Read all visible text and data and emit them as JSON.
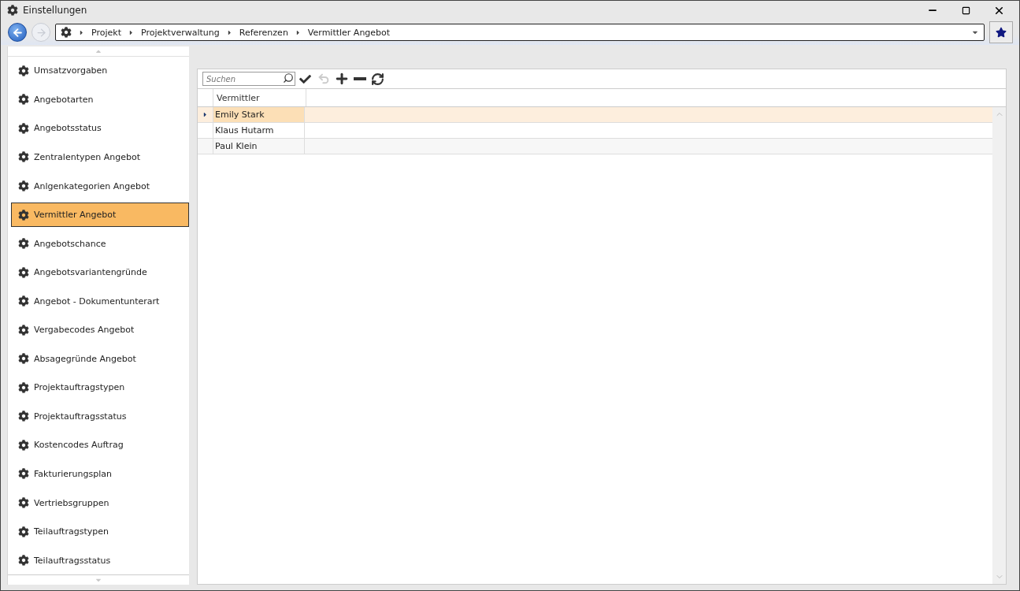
{
  "window": {
    "title": "Einstellungen"
  },
  "breadcrumb": [
    "Projekt",
    "Projektverwaltung",
    "Referenzen",
    "Vermittler Angebot"
  ],
  "sidebar": {
    "items": [
      {
        "label": "Umsatzvorgaben",
        "selected": false
      },
      {
        "label": "Angebotarten",
        "selected": false
      },
      {
        "label": "Angebotsstatus",
        "selected": false
      },
      {
        "label": "Zentralentypen Angebot",
        "selected": false
      },
      {
        "label": "Anlgenkategorien Angebot",
        "selected": false
      },
      {
        "label": "Vermittler Angebot",
        "selected": true
      },
      {
        "label": "Angebotschance",
        "selected": false
      },
      {
        "label": "Angebotsvariantengründe",
        "selected": false
      },
      {
        "label": "Angebot - Dokumentunterart",
        "selected": false
      },
      {
        "label": "Vergabecodes Angebot",
        "selected": false
      },
      {
        "label": "Absagegründe Angebot",
        "selected": false
      },
      {
        "label": "Projektauftragstypen",
        "selected": false
      },
      {
        "label": "Projektauftragsstatus",
        "selected": false
      },
      {
        "label": "Kostencodes Auftrag",
        "selected": false
      },
      {
        "label": "Fakturierungsplan",
        "selected": false
      },
      {
        "label": "Vertriebsgruppen",
        "selected": false
      },
      {
        "label": "Teilauftragstypen",
        "selected": false
      },
      {
        "label": "Teilauftragsstatus",
        "selected": false
      }
    ]
  },
  "toolbar": {
    "search": {
      "placeholder": "Suchen"
    },
    "undo_disabled": true
  },
  "table": {
    "columns": [
      "Vermittler"
    ],
    "rows": [
      {
        "name": "Emily Stark",
        "selected": true
      },
      {
        "name": "Klaus Hutarm",
        "selected": false
      },
      {
        "name": "Paul Klein",
        "selected": false
      }
    ]
  }
}
